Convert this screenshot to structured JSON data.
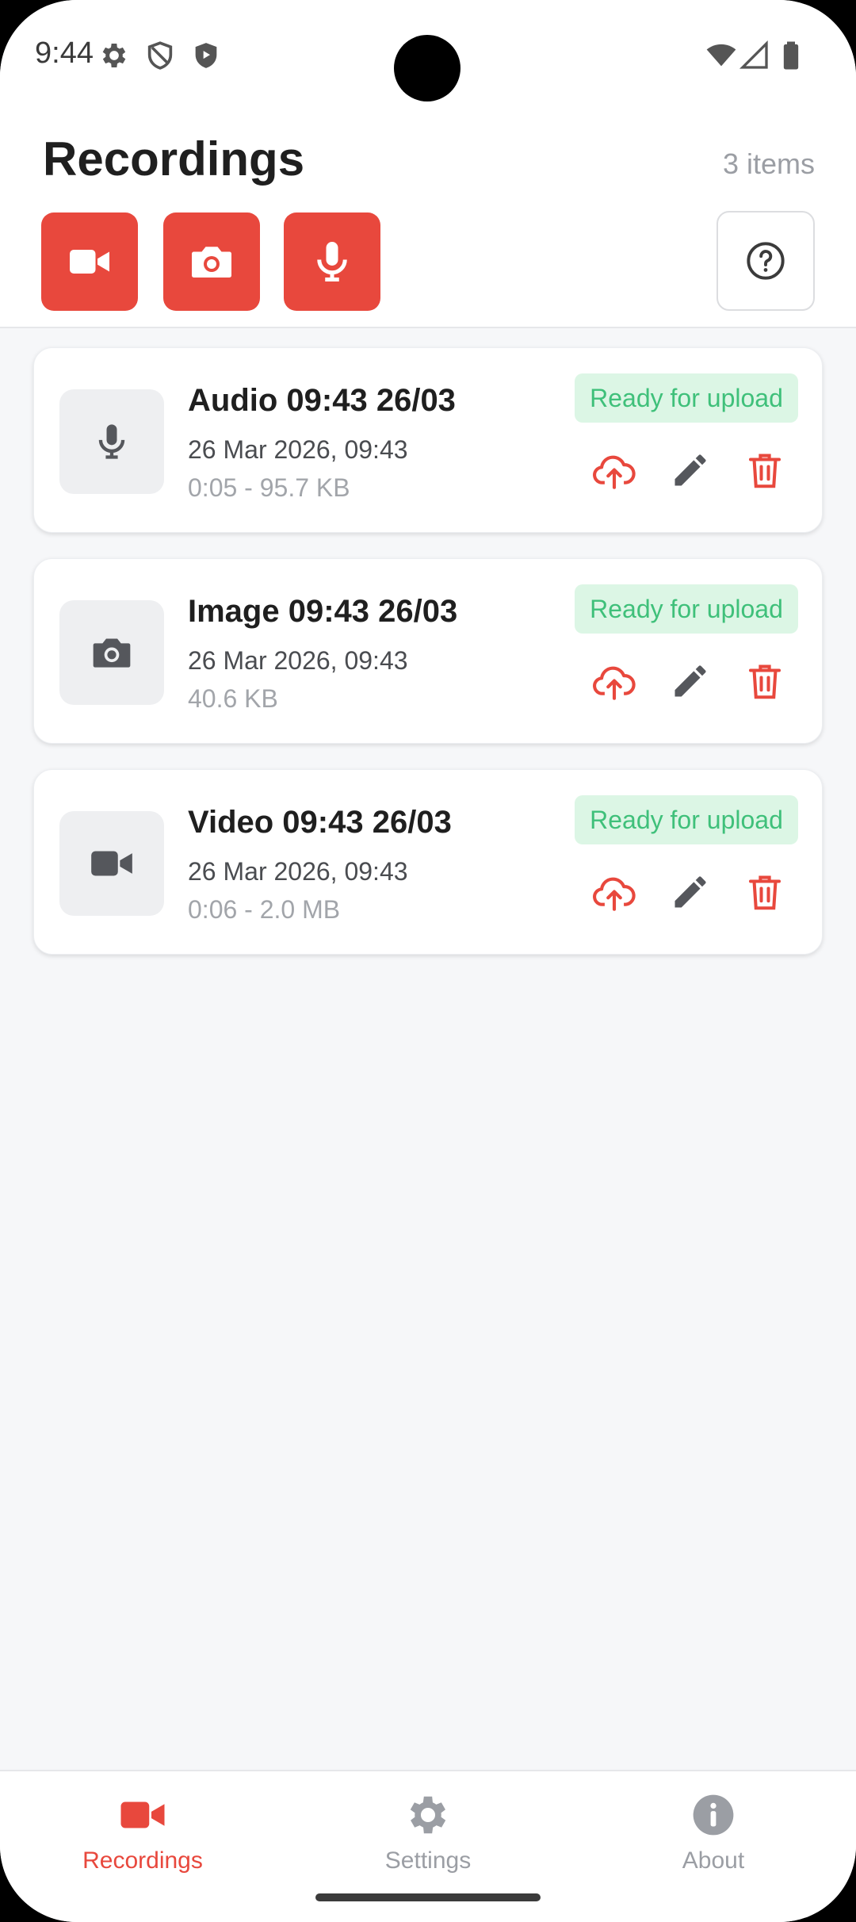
{
  "status_bar": {
    "time": "9:44",
    "left_icons": [
      "gear-icon",
      "shield-outline-icon",
      "shield-filled-icon"
    ],
    "right_icons": [
      "wifi-icon",
      "signal-icon",
      "battery-icon"
    ]
  },
  "header": {
    "title": "Recordings",
    "item_count": "3 items",
    "record_buttons": [
      "video-camera-icon",
      "camera-icon",
      "microphone-icon"
    ],
    "help_icon": "help-circle-icon"
  },
  "colors": {
    "accent": "#e8483d",
    "status_green": "#3fc07a",
    "status_green_bg": "#dcf6e5",
    "inactive": "#9b9ea4"
  },
  "recordings": [
    {
      "type_icon": "microphone-icon",
      "title": "Audio 09:43 26/03",
      "date": "26 Mar 2026, 09:43",
      "meta": "0:05 - 95.7 KB",
      "status": "Ready for upload"
    },
    {
      "type_icon": "camera-icon",
      "title": "Image 09:43 26/03",
      "date": "26 Mar 2026, 09:43",
      "meta": "40.6 KB",
      "status": "Ready for upload"
    },
    {
      "type_icon": "video-camera-icon",
      "title": "Video 09:43 26/03",
      "date": "26 Mar 2026, 09:43",
      "meta": "0:06 - 2.0 MB",
      "status": "Ready for upload"
    }
  ],
  "bottom_nav": {
    "active": "Recordings",
    "items": [
      {
        "label": "Recordings",
        "icon": "video-camera-icon"
      },
      {
        "label": "Settings",
        "icon": "gear-icon"
      },
      {
        "label": "About",
        "icon": "info-icon"
      }
    ]
  }
}
